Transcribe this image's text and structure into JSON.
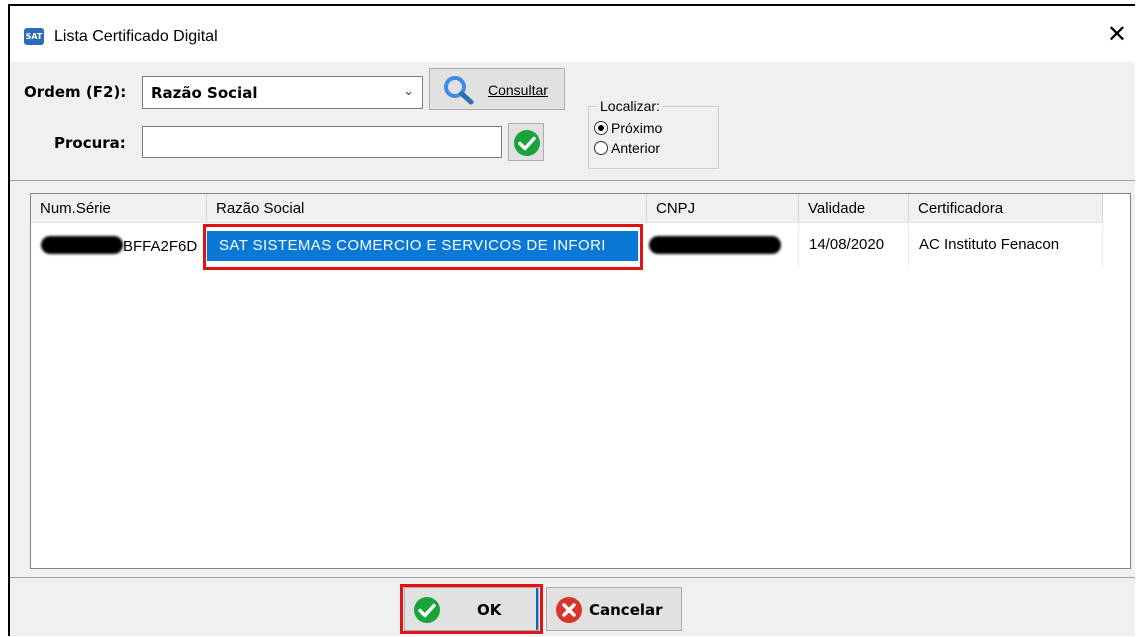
{
  "window": {
    "title": "Lista Certificado Digital",
    "icon": "sat-app-icon",
    "close_glyph": "✕"
  },
  "filter": {
    "ordem_label": "Ordem (F2):",
    "ordem_value": "Razão Social",
    "consultar_label": "Consultar",
    "procura_label": "Procura:",
    "procura_value": "",
    "localizar": {
      "legend": "Localizar:",
      "options": [
        "Próximo",
        "Anterior"
      ],
      "selected": "Próximo"
    }
  },
  "table": {
    "columns": [
      "Num.Série",
      "Razão Social",
      "CNPJ",
      "Validade",
      "Certificadora"
    ],
    "rows": [
      {
        "num_serie_visible": "BFFA2F6D",
        "razao_social": "SAT SISTEMAS COMERCIO E SERVICOS DE INFORI",
        "cnpj": "",
        "validade": "14/08/2020",
        "certificadora": "AC Instituto Fenacon"
      }
    ]
  },
  "footer": {
    "ok_label": "OK",
    "cancel_label": "Cancelar"
  },
  "colors": {
    "selection": "#0a78d7",
    "highlight_box": "#e01414",
    "ok_green": "#1aa33a",
    "cancel_red": "#d9342b"
  }
}
